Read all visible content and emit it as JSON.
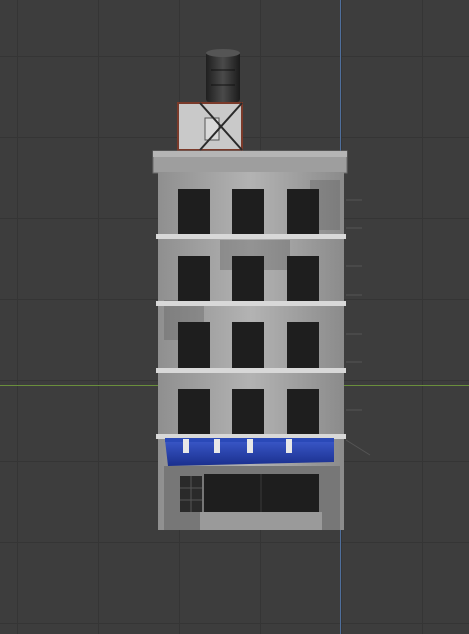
{
  "viewport": {
    "background": "#3d3d3d",
    "grid_color": "#353535",
    "x_axis_color": "#6a8f3c",
    "z_axis_color": "#4f6f9c"
  },
  "model": {
    "facade_color": "#a9a9a9",
    "window_color": "#1e1e1e",
    "ledge_color": "#d8d8d8",
    "awning_color": "#1f3fae",
    "tank_color": "#2a2a2a",
    "floors": 4,
    "windows_per_floor": 3
  }
}
